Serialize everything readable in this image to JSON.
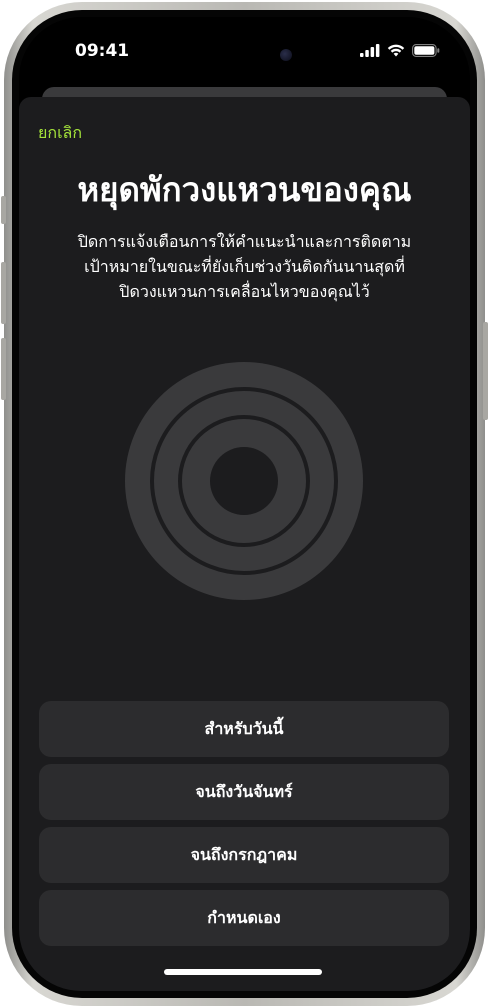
{
  "status_bar": {
    "time": "09:41"
  },
  "sheet": {
    "cancel_label": "ยกเลิก",
    "title": "หยุดพักวงแหวนของคุณ",
    "description_lines": [
      "ปิดการแจ้งเตือนการให้คำแนะนำและการติดตาม",
      "เป้าหมายในขณะที่ยังเก็บช่วงวันติดกันนานสุดที่",
      "ปิดวงแหวนการเคลื่อนไหวของคุณไว้"
    ],
    "options": [
      {
        "label": "สำหรับวันนี้"
      },
      {
        "label": "จนถึงวันจันทร์"
      },
      {
        "label": "จนถึงกรกฎาคม"
      },
      {
        "label": "กำหนดเอง"
      }
    ]
  },
  "colors": {
    "accent": "#a4e33a",
    "sheet_background": "#1c1c1e",
    "button_background": "#2c2c2e",
    "ring_color": "#3a3a3c"
  }
}
